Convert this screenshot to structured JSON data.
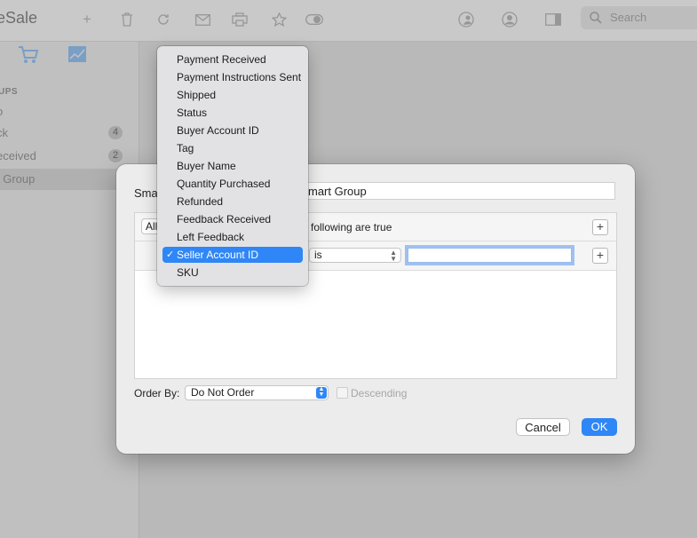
{
  "app": {
    "title_fragment": "eSale"
  },
  "toolbar": {
    "search_placeholder": "Search"
  },
  "sidebar": {
    "heading": "UPS",
    "items": [
      {
        "label": "o",
        "count": ""
      },
      {
        "label": "ck",
        "count": "4"
      },
      {
        "label": "eceived",
        "count": "2"
      },
      {
        "label": "t Group",
        "count": ""
      }
    ]
  },
  "dialog": {
    "name_label": "Sma",
    "name_value": "mart Group",
    "match_value": "All",
    "match_text": "following are true",
    "rule_operator": "is",
    "rule_value": "",
    "order_label": "Order By:",
    "order_value": "Do Not Order",
    "descending_label": "Descending",
    "descending_checked": false,
    "cancel_label": "Cancel",
    "ok_label": "OK"
  },
  "field_menu": {
    "selected": "Seller Account ID",
    "items": [
      "Payment Received",
      "Payment Instructions Sent",
      "Shipped",
      "Status",
      "Buyer Account ID",
      "Tag",
      "Buyer Name",
      "Quantity Purchased",
      "Refunded",
      "Feedback Received",
      "Left Feedback",
      "Seller Account ID",
      "SKU"
    ]
  },
  "colors": {
    "accent": "#2f86f6",
    "menu_bg": "#e2e2e4"
  }
}
